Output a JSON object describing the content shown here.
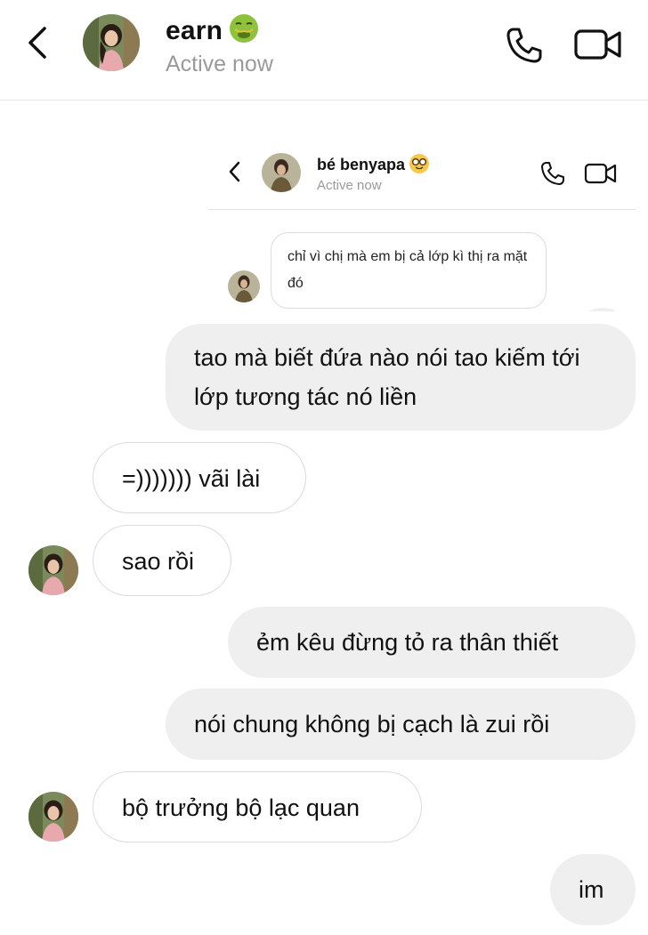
{
  "header": {
    "back_icon": "chevron-left-icon",
    "contact_name": "earn",
    "contact_emoji": "nauseated-face-icon",
    "status": "Active now",
    "call_icon": "phone-icon",
    "video_icon": "video-camera-icon"
  },
  "embedded_screenshot": {
    "contact_name": "bé benyapa",
    "contact_emoji": "nerd-face-icon",
    "status": "Active now",
    "message": "chỉ vì chị mà em bị cả lớp kì thị ra mặt đó"
  },
  "messages": [
    {
      "direction": "outgoing",
      "text": "tao mà biết đứa nào nói tao kiếm tới lớp tương tác nó liền"
    },
    {
      "direction": "incoming",
      "text": "=))))))) vãi lài"
    },
    {
      "direction": "incoming",
      "text": "sao rồi"
    },
    {
      "direction": "outgoing",
      "text": "ẻm kêu đừng tỏ ra thân thiết"
    },
    {
      "direction": "outgoing",
      "text": "nói chung không bị cạch là zui rồi"
    },
    {
      "direction": "incoming",
      "text": "bộ trưởng bộ lạc quan"
    },
    {
      "direction": "outgoing",
      "text": "im"
    }
  ],
  "colors": {
    "outgoing_bubble": "#efefef",
    "incoming_border": "#dbdbdb",
    "status_text": "#9a9a9a"
  }
}
